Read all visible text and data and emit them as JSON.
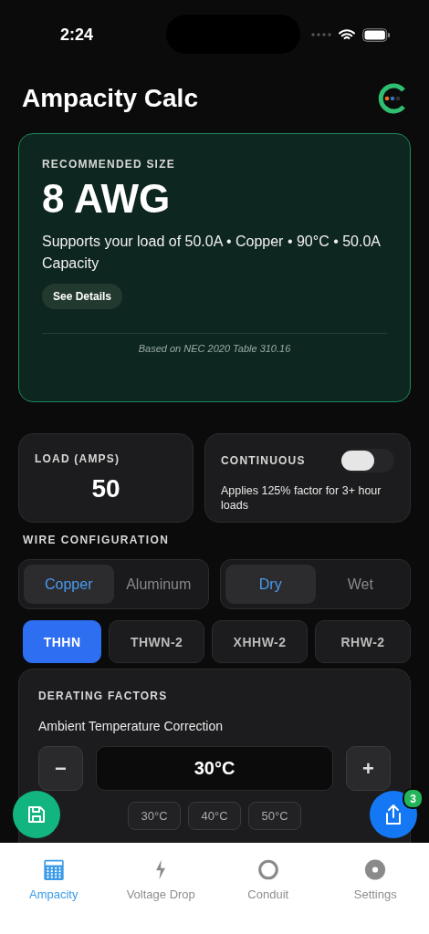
{
  "status_bar": {
    "time": "2:24"
  },
  "header": {
    "title": "Ampacity Calc"
  },
  "result": {
    "label": "RECOMMENDED SIZE",
    "size": "8 AWG",
    "summary": "Supports your load of 50.0A • Copper • 90°C • 50.0A Capacity",
    "details_button": "See Details",
    "footnote": "Based on NEC 2020 Table 310.16"
  },
  "load": {
    "label": "LOAD (AMPS)",
    "value": "50"
  },
  "continuous": {
    "label": "CONTINUOUS",
    "on": false,
    "description": "Applies 125% factor for 3+ hour loads"
  },
  "wire_configuration": {
    "label": "WIRE CONFIGURATION",
    "material": [
      {
        "label": "Copper",
        "selected": true
      },
      {
        "label": "Aluminum",
        "selected": false
      }
    ],
    "location": [
      {
        "label": "Dry",
        "selected": true
      },
      {
        "label": "Wet",
        "selected": false
      }
    ],
    "insulation": [
      {
        "label": "THHN",
        "selected": true
      },
      {
        "label": "THWN-2",
        "selected": false
      },
      {
        "label": "XHHW-2",
        "selected": false
      },
      {
        "label": "RHW-2",
        "selected": false
      }
    ]
  },
  "derating": {
    "label": "DERATING FACTORS",
    "ambient_label": "Ambient Temperature Correction",
    "decrement": "−",
    "value": "30°C",
    "increment": "+",
    "presets": [
      "30°C",
      "40°C",
      "50°C"
    ]
  },
  "share_badge": "3",
  "tab_bar": [
    {
      "label": "Ampacity",
      "selected": true
    },
    {
      "label": "Voltage Drop",
      "selected": false
    },
    {
      "label": "Conduit",
      "selected": false
    },
    {
      "label": "Settings",
      "selected": false
    }
  ]
}
